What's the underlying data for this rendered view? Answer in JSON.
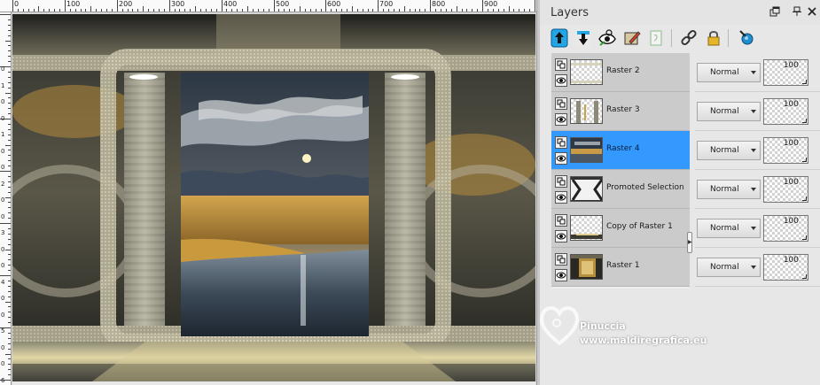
{
  "ruler": {
    "top_labels": [
      "0",
      "100",
      "200",
      "300",
      "400",
      "500",
      "600",
      "700",
      "800",
      "900"
    ],
    "left_labels": [
      "0",
      "1",
      "0",
      "0",
      "1",
      "0",
      "0",
      "2",
      "0",
      "0",
      "3",
      "0",
      "0",
      "4",
      "0",
      "0",
      "5",
      "0",
      "0",
      "6"
    ]
  },
  "palette": {
    "title": "Layers",
    "header_icons": [
      "restore-icon",
      "pin-icon",
      "close-icon"
    ],
    "toolbar_icons": [
      "move-layer-up-icon",
      "move-layer-down-icon",
      "toggle-visibility-icon",
      "edit-layer-icon",
      "new-layer-icon",
      "link-icon",
      "lock-icon",
      "layer-properties-icon"
    ]
  },
  "layers": [
    {
      "name": "Raster 2",
      "blend_mode": "Normal",
      "opacity": "100",
      "selected": false,
      "thumb": "stripes-light"
    },
    {
      "name": "Raster 3",
      "blend_mode": "Normal",
      "opacity": "100",
      "selected": false,
      "thumb": "pillars"
    },
    {
      "name": "Raster 4",
      "blend_mode": "Normal",
      "opacity": "100",
      "selected": true,
      "thumb": "landscape"
    },
    {
      "name": "Promoted Selection",
      "blend_mode": "Normal",
      "opacity": "100",
      "selected": false,
      "thumb": "frame-dark"
    },
    {
      "name": "Copy of Raster 1",
      "blend_mode": "Normal",
      "opacity": "100",
      "selected": false,
      "thumb": "floor"
    },
    {
      "name": "Raster 1",
      "blend_mode": "Normal",
      "opacity": "100",
      "selected": false,
      "thumb": "scene-dark"
    }
  ],
  "watermark": {
    "name": "Pinuccia",
    "url": "www.maldiregrafica.eu"
  },
  "colors": {
    "selection": "#3399ff",
    "row": "#cbcbcb",
    "gold": "#c9a24a"
  }
}
